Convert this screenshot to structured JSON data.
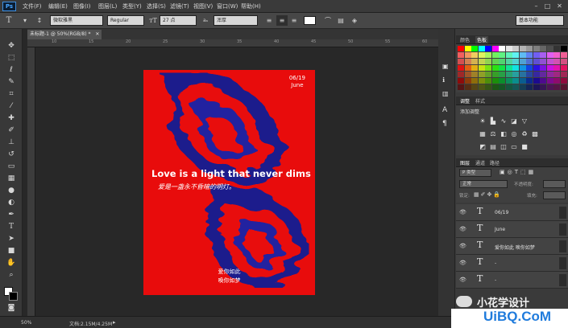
{
  "app": {
    "logo": "Ps"
  },
  "menu": [
    "文件(F)",
    "编辑(E)",
    "图像(I)",
    "图层(L)",
    "类型(Y)",
    "选择(S)",
    "滤镜(T)",
    "视图(V)",
    "窗口(W)",
    "帮助(H)"
  ],
  "options": {
    "tool_glyph": "T",
    "font_family": "微软雅黑",
    "font_style": "Regular",
    "font_size": "27 点",
    "antialias": "浑厚",
    "workspace": "基本功能"
  },
  "document": {
    "tab_title": "未标题-1 @ 50%(RGB/8) *"
  },
  "rulers": [
    "10",
    "15",
    "20",
    "25",
    "30",
    "35",
    "40",
    "45",
    "50",
    "55",
    "60"
  ],
  "artwork": {
    "date": "06/19",
    "month": "June",
    "headline": "Love is a light that never dims",
    "subline": "爱是一盏永不昏暗的明灯。",
    "bottom_line1": "爱你如此",
    "bottom_line2": "唤你如梦"
  },
  "panels": {
    "color_tabs": [
      "颜色",
      "色板"
    ],
    "adjust_tabs": [
      "调整",
      "样式"
    ],
    "adjust_title": "添加调整",
    "layers_tabs": [
      "图层",
      "通道",
      "路径"
    ],
    "kind_label": "P 类型",
    "blend_mode": "正常",
    "opacity_label": "不透明度:",
    "lock_label": "锁定:",
    "fill_label": "填充:"
  },
  "layers": [
    {
      "name": "06/19"
    },
    {
      "name": "June"
    },
    {
      "name": "爱你如此 唤你如梦"
    },
    {
      "name": "-"
    },
    {
      "name": "-"
    }
  ],
  "status": {
    "zoom": "50%",
    "doc": "文档:2.15M/4.25M"
  },
  "watermark": {
    "text1": "小花学设计",
    "text2": "UiBQ.CoM"
  },
  "colors": {
    "canvas_red": "#e80c0c",
    "swirl_blue": "#1c1c8c",
    "accent_blue": "#1f7bdc"
  }
}
